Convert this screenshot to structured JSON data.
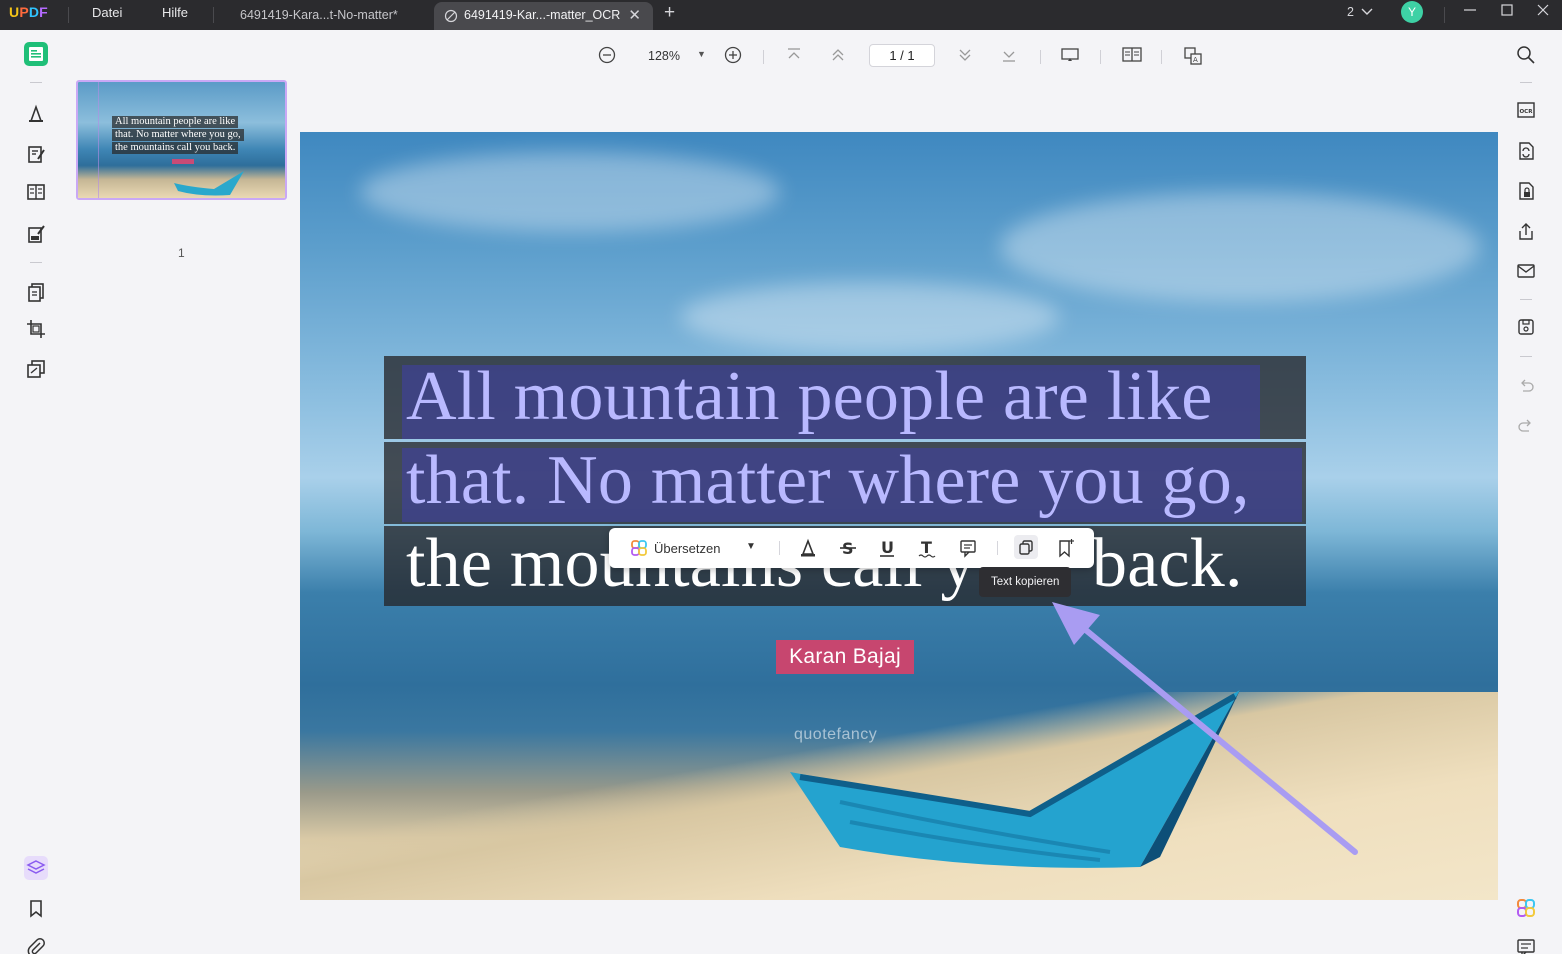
{
  "app": {
    "logo": "UPDF",
    "menu": [
      "Datei",
      "Hilfe"
    ],
    "tabs": [
      {
        "label": "6491419-Kara...t-No-matter*",
        "active": false
      },
      {
        "label": "6491419-Kar...-matter_OCR",
        "active": true
      }
    ],
    "window_count": "2",
    "avatar_initial": "Y"
  },
  "toolbar": {
    "zoom": "128%",
    "page_indicator": "1  /  1"
  },
  "thumbnails": {
    "page_number": "1",
    "lines": [
      "All mountain people are like",
      "that. No matter where you go,",
      "the mountains call you back."
    ]
  },
  "document": {
    "quote_lines": [
      "All mountain people are like",
      "that. No matter where you go,",
      "the mountains call y",
      "back."
    ],
    "author": "Karan Bajaj",
    "watermark": "quotefancy"
  },
  "selection_toolbar": {
    "translate_label": "Übersetzen",
    "tooltip": "Text kopieren"
  },
  "colors": {
    "titlebar": "#2b2b2e",
    "accent_green": "#3ed1a5",
    "selection_text": "#b9b9ff",
    "arrow": "#a99cf2",
    "author_badge": "#c7466f"
  },
  "icons": {
    "left": [
      "reader-icon",
      "comment-icon",
      "edit-pdf-icon",
      "form-icon",
      "fill-sign-icon",
      "organize-pages-icon",
      "crop-icon",
      "batch-icon",
      "layers-icon",
      "bookmark-icon",
      "attachment-icon"
    ],
    "right": [
      "search-icon",
      "ocr-icon",
      "convert-icon",
      "protect-icon",
      "share-icon",
      "email-icon",
      "save-icon",
      "undo-icon",
      "redo-icon",
      "ai-assistant-icon",
      "comments-panel-icon"
    ]
  }
}
